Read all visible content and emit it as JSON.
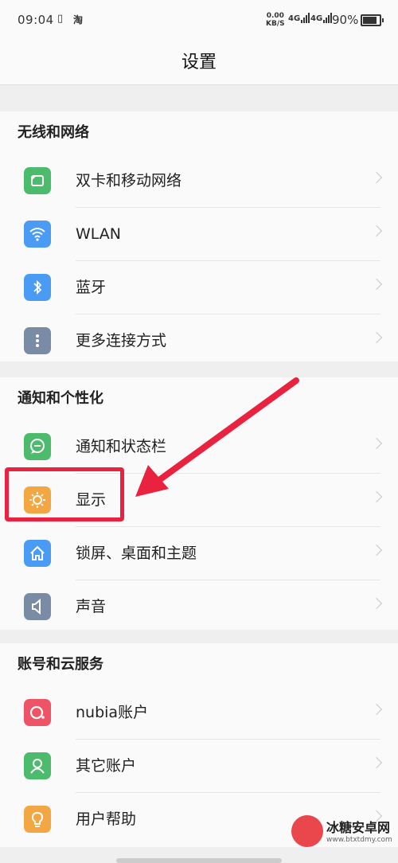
{
  "status_bar": {
    "time": "09:04",
    "vibrate_glyph": "▯",
    "taobao_glyph": "淘",
    "net_speed_value": "0.00",
    "net_speed_unit": "KB/S",
    "signal1_label": "4G",
    "signal2_label": "4G",
    "battery": "90%"
  },
  "header": {
    "title": "设置"
  },
  "sections": [
    {
      "title": "无线和网络",
      "items": [
        {
          "label": "双卡和移动网络",
          "icon": "sim-card-icon",
          "color": "#4cbb6b"
        },
        {
          "label": "WLAN",
          "icon": "wifi-icon",
          "color": "#4a9bf4"
        },
        {
          "label": "蓝牙",
          "icon": "bluetooth-icon",
          "color": "#4a9bf4"
        },
        {
          "label": "更多连接方式",
          "icon": "more-dots-icon",
          "color": "#7a8ba6"
        }
      ]
    },
    {
      "title": "通知和个性化",
      "items": [
        {
          "label": "通知和状态栏",
          "icon": "chat-bubble-icon",
          "color": "#4cbb6b"
        },
        {
          "label": "显示",
          "icon": "brightness-icon",
          "color": "#f3a742"
        },
        {
          "label": "锁屏、桌面和主题",
          "icon": "home-icon",
          "color": "#4a9bf4"
        },
        {
          "label": "声音",
          "icon": "speaker-icon",
          "color": "#7a8ba6"
        }
      ]
    },
    {
      "title": "账号和云服务",
      "items": [
        {
          "label": "nubia账户",
          "icon": "nubia-account-icon",
          "color": "#ee5465"
        },
        {
          "label": "其它账户",
          "icon": "user-icon",
          "color": "#4cbb6b"
        },
        {
          "label": "用户帮助",
          "icon": "lightbulb-icon",
          "color": "#f3a742"
        }
      ]
    }
  ],
  "watermark": {
    "title": "冰糖安卓网",
    "url": "www.btxtdmy.com"
  },
  "colors": {
    "highlight": "#e8223f",
    "arrow": "#e8223f"
  }
}
